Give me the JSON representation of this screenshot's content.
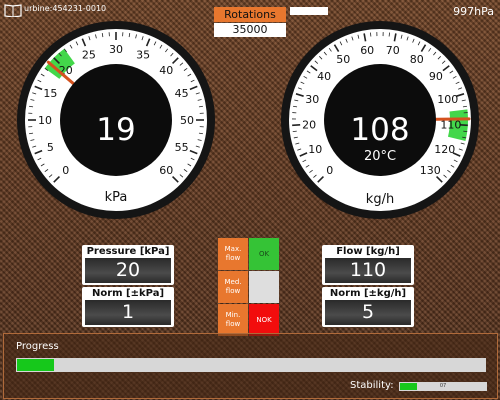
{
  "header": {
    "turbine_id": "urbine:454231-0010",
    "ambient_pressure": "997hPa",
    "rotations_label": "Rotations",
    "rotations_value": "35000",
    "top_field_value": ""
  },
  "gauge_pressure": {
    "value": "19",
    "unit": "kPa",
    "needle": 19,
    "min": 0,
    "max": 60,
    "tick_labels": [
      "0",
      "5",
      "10",
      "15",
      "20",
      "25",
      "30",
      "35",
      "40",
      "45",
      "50",
      "55",
      "60"
    ],
    "norm_from": 18,
    "norm_to": 22,
    "norm_color": "#22d02a",
    "needle_color": "#d4521e"
  },
  "gauge_flow": {
    "value": "108",
    "temperature": "20°C",
    "unit": "kg/h",
    "needle": 108,
    "min": 0,
    "max": 130,
    "tick_labels": [
      "0",
      "10",
      "20",
      "30",
      "40",
      "50",
      "60",
      "70",
      "80",
      "90",
      "100",
      "110",
      "120",
      "130"
    ],
    "norm_from": 105,
    "norm_to": 115,
    "norm_color": "#22d02a",
    "needle_color": "#d4521e"
  },
  "displays": {
    "pressure_label": "Pressure [kPa]",
    "pressure_value": "20",
    "norm_kpa_label": "Norm [±kPa]",
    "norm_kpa_value": "1",
    "flow_label": "Flow [kg/h]",
    "flow_value": "110",
    "norm_kgh_label": "Norm [±kg/h]",
    "norm_kgh_value": "5"
  },
  "flow_indicators": {
    "max_label": "Max. flow",
    "max_status": "OK",
    "max_color": "#35c336",
    "med_label": "Med. flow",
    "med_status": "",
    "med_color": "#dedede",
    "min_label": "Min. flow",
    "min_status": "NOK",
    "min_color": "#f20d0d"
  },
  "footer": {
    "progress_label": "Progress",
    "progress_fraction": 0.08,
    "stability_label": "Stability:",
    "stability_value": "07",
    "stability_fraction": 0.2
  }
}
